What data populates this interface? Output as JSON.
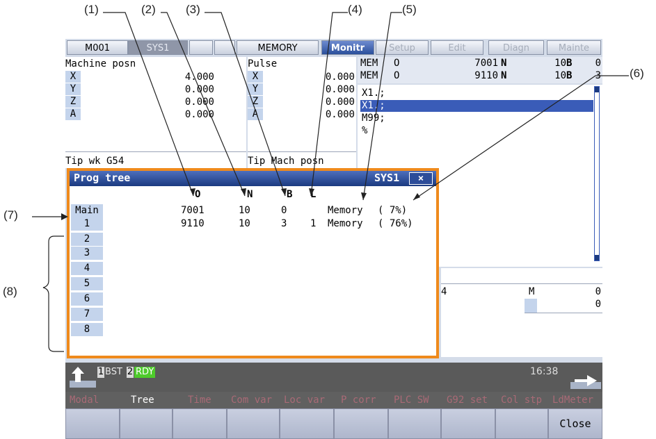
{
  "callouts": [
    "(1)",
    "(2)",
    "(3)",
    "(4)",
    "(5)",
    "(6)",
    "(7)",
    "(8)"
  ],
  "top_tabs": [
    "M001",
    "SYS1",
    "MEMORY",
    "Monitr",
    "Setup",
    "Edit",
    "Diagn",
    "Mainte"
  ],
  "machine": {
    "title": "Machine posn",
    "axes": [
      "X",
      "Y",
      "Z",
      "A"
    ],
    "values": [
      "4.000",
      "0.000",
      "0.000",
      "0.000"
    ],
    "footer": "Tip wk G54"
  },
  "pulse": {
    "title": "Pulse",
    "axes": [
      "X",
      "Y",
      "Z",
      "A"
    ],
    "values": [
      "0.000",
      "0.000",
      "0.000",
      "0.000"
    ],
    "footer": "Tip Mach posn"
  },
  "mem_rows": [
    {
      "mode": "MEM",
      "o_lbl": "O",
      "o": "7001",
      "n_lbl": "N",
      "n": "10",
      "b_lbl": "B",
      "b": "0"
    },
    {
      "mode": "MEM",
      "o_lbl": "O",
      "o": "9110",
      "n_lbl": "N",
      "n": "10",
      "b_lbl": "B",
      "b": "3"
    }
  ],
  "program_lines": [
    "X1.;",
    "X1.;",
    "M99;",
    "%"
  ],
  "mstatus": {
    "left_val": "4",
    "m_lbl": "M",
    "m1": "0",
    "m2": "0"
  },
  "popup": {
    "title": "Prog tree",
    "sys": "SYS1",
    "close": "×",
    "headers": {
      "o": "O",
      "n": "N",
      "b": "B",
      "l": "L"
    },
    "labels": [
      "Main",
      "1",
      "2",
      "3",
      "4",
      "5",
      "6",
      "7",
      "8"
    ],
    "rows": [
      {
        "o": "7001",
        "n": "10",
        "b": "0",
        "l": "",
        "device": "Memory",
        "pct": "( 7%)"
      },
      {
        "o": "9110",
        "n": "10",
        "b": "3",
        "l": "1",
        "device": "Memory",
        "pct": "( 76%)"
      }
    ]
  },
  "status": {
    "n1": "1",
    "s1": "BST",
    "n2": "2",
    "s2": "RDY",
    "time": "16:38"
  },
  "menu": [
    "Modal",
    "Tree",
    "Time",
    "Com var",
    "Loc var",
    "P corr",
    "PLC SW",
    "G92 set",
    "Col stp",
    "LdMeter"
  ],
  "fkeys": [
    "",
    "",
    "",
    "",
    "",
    "",
    "",
    "",
    "",
    "Close"
  ],
  "colors": {
    "accent_orange": "#ef8a1c",
    "title_blue": "#1b3a80",
    "rdy_green": "#4ecb2c"
  }
}
